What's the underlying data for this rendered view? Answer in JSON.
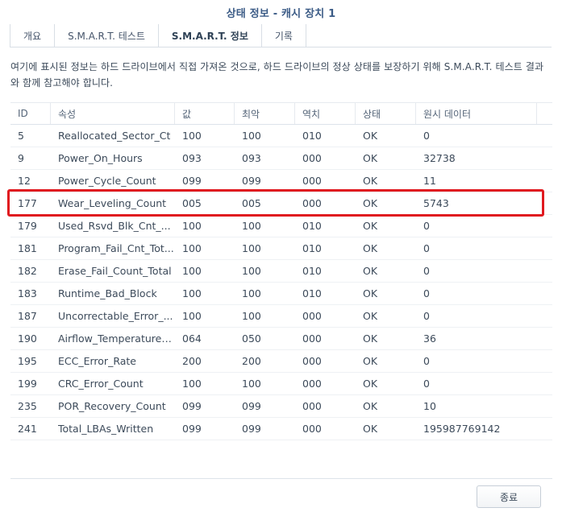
{
  "window": {
    "title": "상태 정보 - 캐시 장치 1"
  },
  "tabs": [
    {
      "label": "개요"
    },
    {
      "label": "S.M.A.R.T. 테스트"
    },
    {
      "label": "S.M.A.R.T. 정보",
      "active": true
    },
    {
      "label": "기록"
    }
  ],
  "description": "여기에 표시된 정보는 하드 드라이브에서 직접 가져온 것으로, 하드 드라이브의 정상 상태를 보장하기 위해 S.M.A.R.T. 테스트 결과와 함께 참고해야 합니다.",
  "table": {
    "headers": [
      "ID",
      "속성",
      "값",
      "최악",
      "역치",
      "상태",
      "원시 데이터"
    ],
    "rows": [
      [
        "5",
        "Reallocated_Sector_Ct",
        "100",
        "100",
        "010",
        "OK",
        "0"
      ],
      [
        "9",
        "Power_On_Hours",
        "093",
        "093",
        "000",
        "OK",
        "32738"
      ],
      [
        "12",
        "Power_Cycle_Count",
        "099",
        "099",
        "000",
        "OK",
        "11"
      ],
      [
        "177",
        "Wear_Leveling_Count",
        "005",
        "005",
        "000",
        "OK",
        "5743"
      ],
      [
        "179",
        "Used_Rsvd_Blk_Cnt_...",
        "100",
        "100",
        "010",
        "OK",
        "0"
      ],
      [
        "181",
        "Program_Fail_Cnt_Tot...",
        "100",
        "100",
        "010",
        "OK",
        "0"
      ],
      [
        "182",
        "Erase_Fail_Count_Total",
        "100",
        "100",
        "010",
        "OK",
        "0"
      ],
      [
        "183",
        "Runtime_Bad_Block",
        "100",
        "100",
        "010",
        "OK",
        "0"
      ],
      [
        "187",
        "Uncorrectable_Error_...",
        "100",
        "100",
        "000",
        "OK",
        "0"
      ],
      [
        "190",
        "Airflow_Temperature_...",
        "064",
        "050",
        "000",
        "OK",
        "36"
      ],
      [
        "195",
        "ECC_Error_Rate",
        "200",
        "200",
        "000",
        "OK",
        "0"
      ],
      [
        "199",
        "CRC_Error_Count",
        "100",
        "100",
        "000",
        "OK",
        "0"
      ],
      [
        "235",
        "POR_Recovery_Count",
        "099",
        "099",
        "000",
        "OK",
        "10"
      ],
      [
        "241",
        "Total_LBAs_Written",
        "099",
        "099",
        "000",
        "OK",
        "195987769142"
      ]
    ],
    "highlighted_row_id": "177"
  },
  "footer": {
    "close_label": "종료"
  },
  "colors": {
    "title": "#3b5b86",
    "highlight": "#e0191f"
  }
}
